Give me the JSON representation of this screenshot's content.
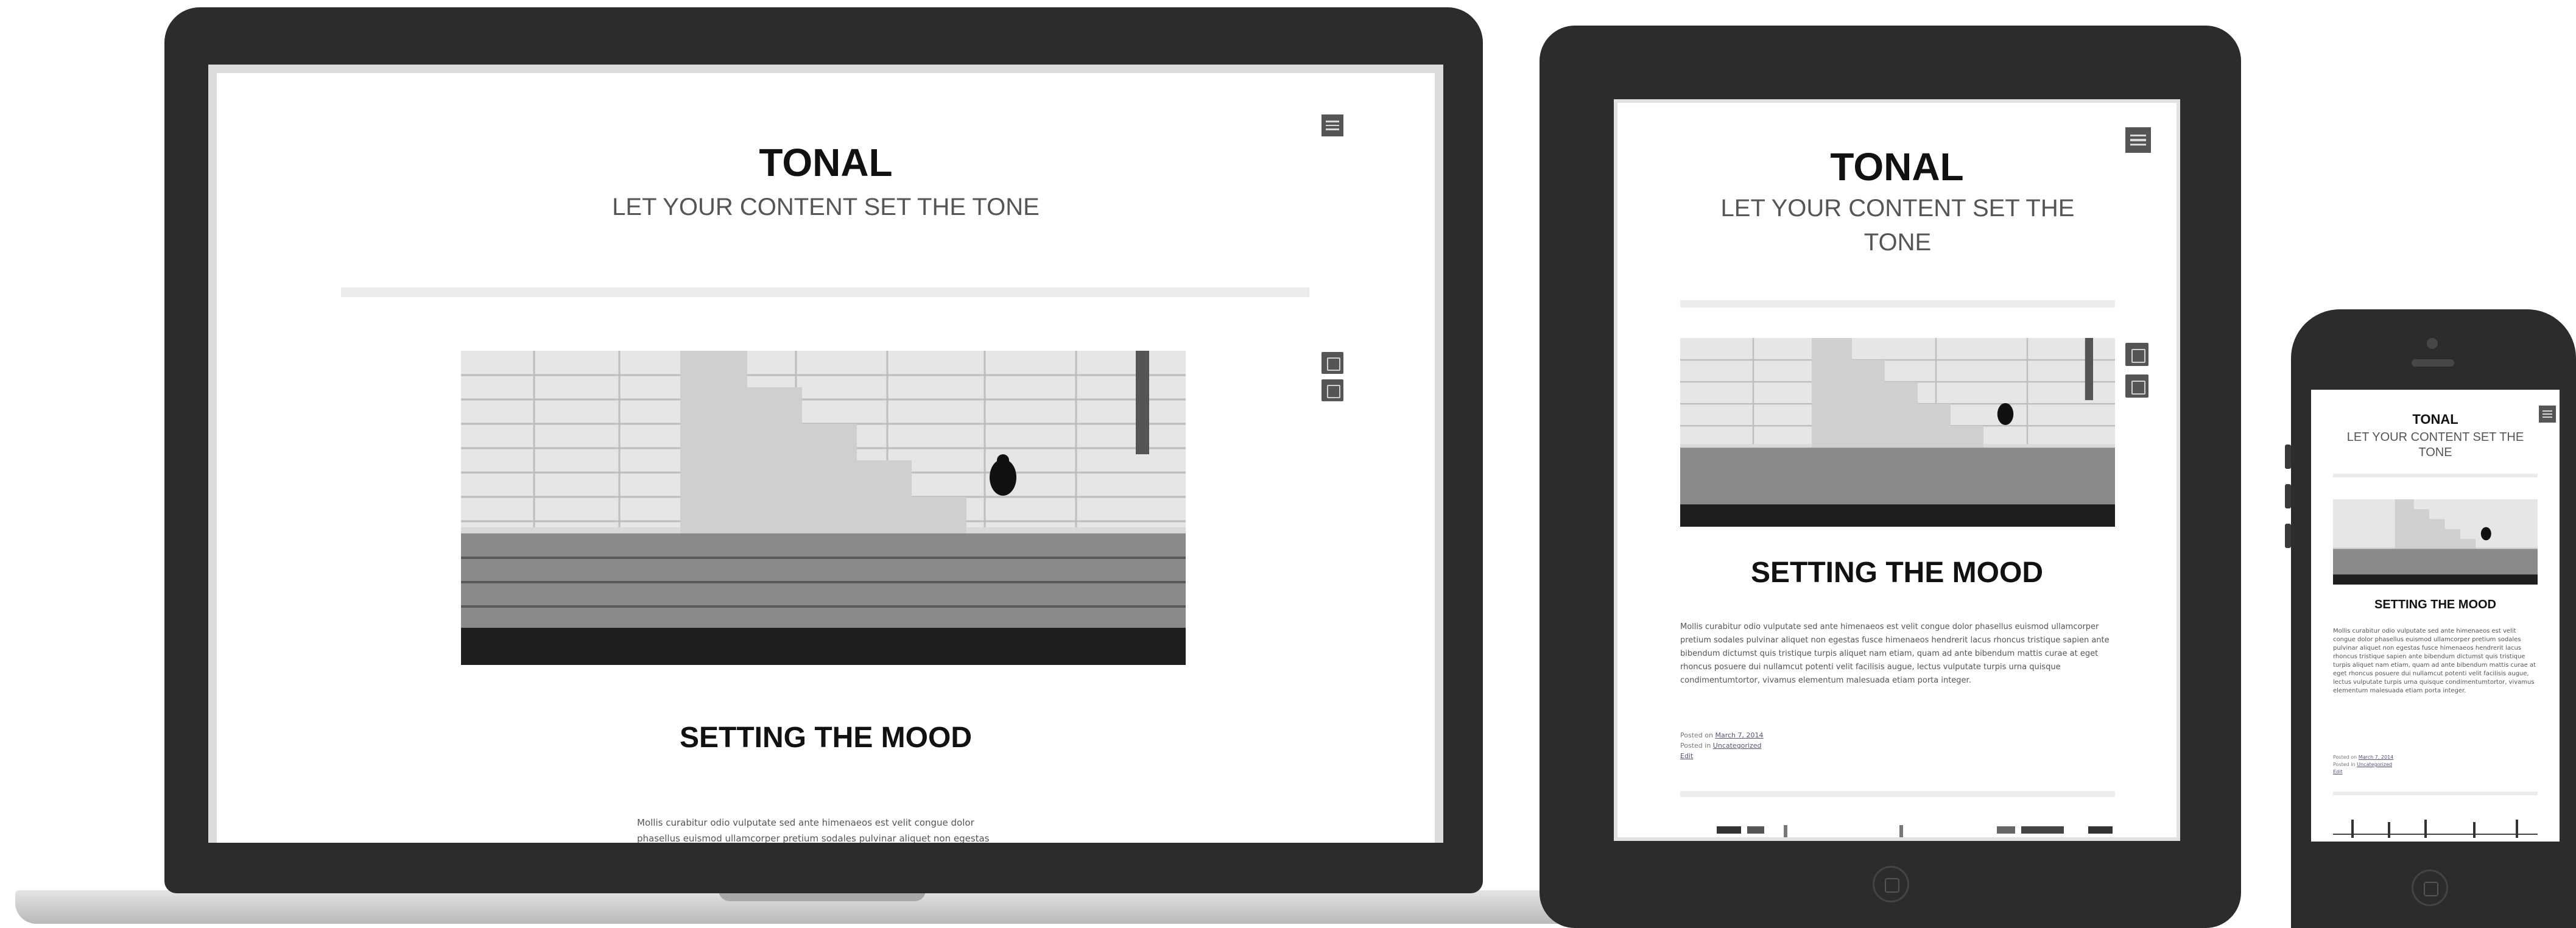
{
  "site": {
    "title": "TONAL",
    "tagline": "LET YOUR CONTENT SET THE TONE"
  },
  "post": {
    "title": "SETTING THE MOOD",
    "excerpt": "Mollis curabitur odio vulputate sed ante himenaeos est velit congue dolor phasellus euismod ullamcorper pretium sodales pulvinar aliquet non egestas fusce himenaeos hendrerit lacus rhoncus tristique sapien ante bibendum dictumst quis tristique turpis aliquet nam etiam, quam ad ante bibendum mattis curae at eget rhoncus posuere dui nullamcut potenti velit facilisis augue, lectus vulputate turpis urna quisque condimentumtortor, vivamus elementum malesuada etiam porta integer.",
    "posted_on_prefix": "Posted on",
    "posted_on_date": "March 7, 2014",
    "posted_in_prefix": "Posted in",
    "posted_in_category": "Uncategorized",
    "edit_label": "Edit"
  },
  "icons": {
    "menu": "hamburger-menu-icon",
    "format": "image-format-icon",
    "comments": "comment-icon"
  },
  "colors": {
    "device_frame": "#2c2c2c",
    "text": "#111111",
    "tagline": "#555555",
    "divider": "#ececec"
  }
}
